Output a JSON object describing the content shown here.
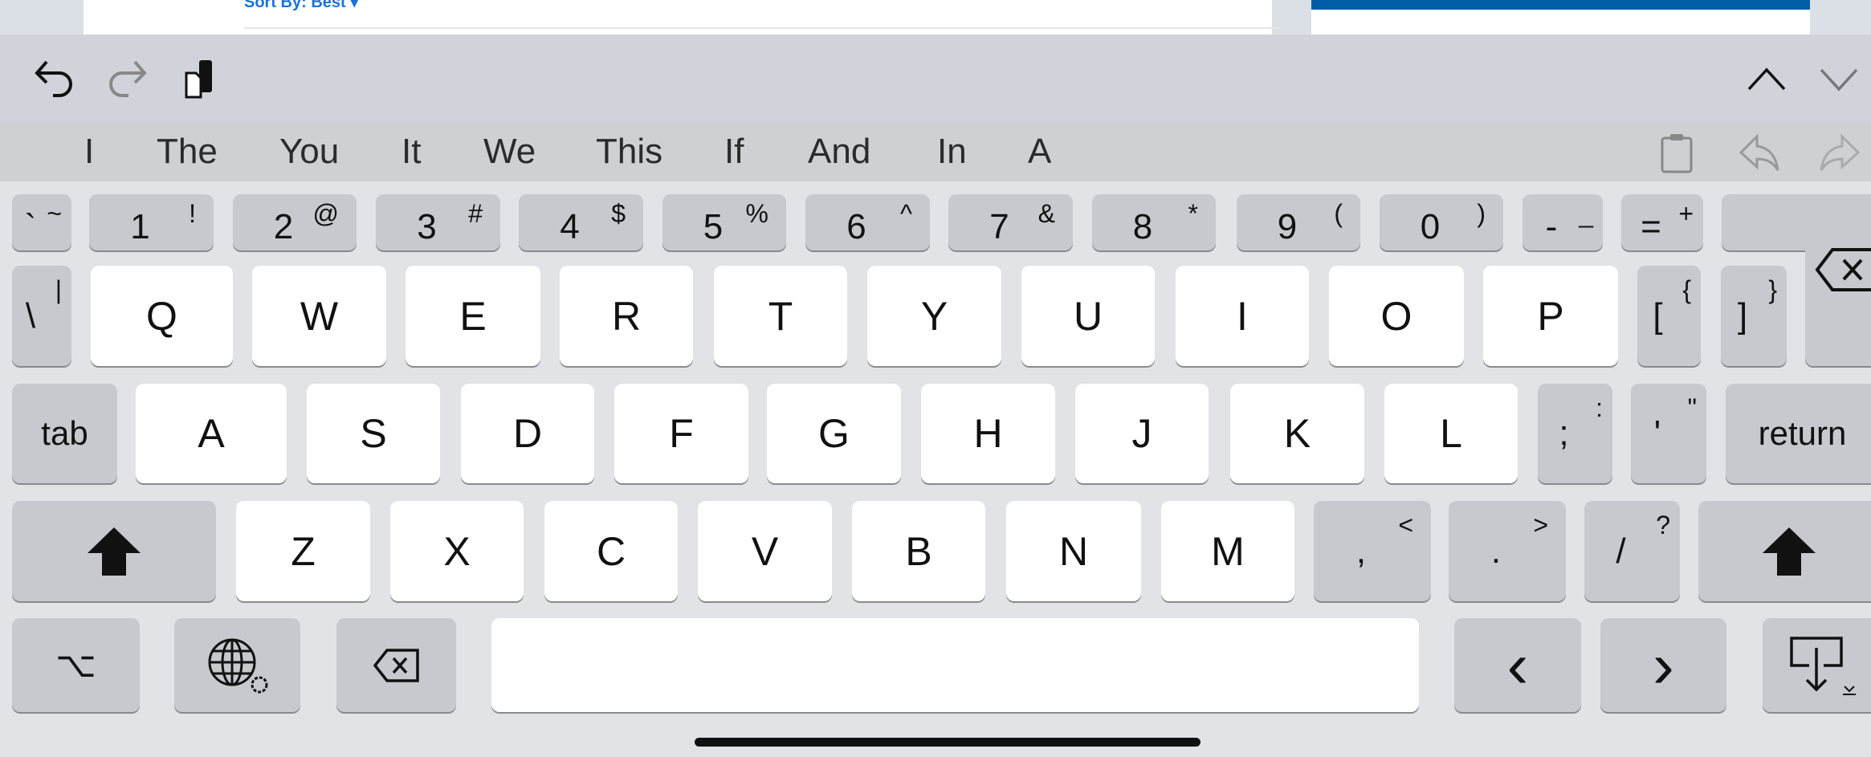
{
  "web": {
    "sort_label": "Sort By: Best",
    "accent": "#005ea6",
    "link_color": "#1a73d9"
  },
  "toolbar": {
    "icons": [
      "undo-icon",
      "redo-icon",
      "paste-icon",
      "chevron-up-icon",
      "chevron-down-icon"
    ]
  },
  "predictions": [
    "I",
    "The",
    "You",
    "It",
    "We",
    "This",
    "If",
    "And",
    "In",
    "A"
  ],
  "prediction_icons": [
    "clipboard-icon",
    "reply-icon",
    "forward-icon"
  ],
  "keys": [
    [
      {
        "m": "`",
        "s": "~"
      },
      {
        "m": "1",
        "s": "!"
      },
      {
        "m": "2",
        "s": "@"
      },
      {
        "m": "3",
        "s": "#"
      },
      {
        "m": "4",
        "s": "$"
      },
      {
        "m": "5",
        "s": "%"
      },
      {
        "m": "6",
        "s": "^"
      },
      {
        "m": "7",
        "s": "&"
      },
      {
        "m": "8",
        "s": "*"
      },
      {
        "m": "9",
        "s": "("
      },
      {
        "m": "0",
        "s": ")"
      },
      {
        "m": "-",
        "s": "_"
      },
      {
        "m": "=",
        "s": "+"
      }
    ],
    [
      {
        "m": "\\",
        "s": "|"
      },
      {
        "m": "Q"
      },
      {
        "m": "W"
      },
      {
        "m": "E"
      },
      {
        "m": "R"
      },
      {
        "m": "T"
      },
      {
        "m": "Y"
      },
      {
        "m": "U"
      },
      {
        "m": "I"
      },
      {
        "m": "O"
      },
      {
        "m": "P"
      },
      {
        "m": "[",
        "s": "{"
      },
      {
        "m": "]",
        "s": "}"
      }
    ],
    [
      {
        "m": "tab"
      },
      {
        "m": "A"
      },
      {
        "m": "S"
      },
      {
        "m": "D"
      },
      {
        "m": "F"
      },
      {
        "m": "G"
      },
      {
        "m": "H"
      },
      {
        "m": "J"
      },
      {
        "m": "K"
      },
      {
        "m": "L"
      },
      {
        "m": ";",
        "s": ":"
      },
      {
        "m": "'",
        "s": "\""
      },
      {
        "m": "return"
      }
    ],
    [
      {
        "m": "",
        "icon": "shift-icon"
      },
      {
        "m": "Z"
      },
      {
        "m": "X"
      },
      {
        "m": "C"
      },
      {
        "m": "V"
      },
      {
        "m": "B"
      },
      {
        "m": "N"
      },
      {
        "m": "M"
      },
      {
        "m": ",",
        "s": "<"
      },
      {
        "m": ".",
        "s": ">"
      },
      {
        "m": "/",
        "s": "?"
      },
      {
        "m": "",
        "icon": "shift-icon"
      }
    ],
    [
      {
        "m": "⌥",
        "icon": "option-icon"
      },
      {
        "m": "",
        "icon": "globe-icon"
      },
      {
        "m": "",
        "icon": "delete-icon"
      },
      {
        "m": "",
        "icon": "space"
      },
      {
        "m": "‹",
        "icon": "arrow-left-icon"
      },
      {
        "m": "›",
        "icon": "arrow-right-icon"
      },
      {
        "m": "",
        "icon": "keyboard-dismiss-icon"
      }
    ]
  ]
}
